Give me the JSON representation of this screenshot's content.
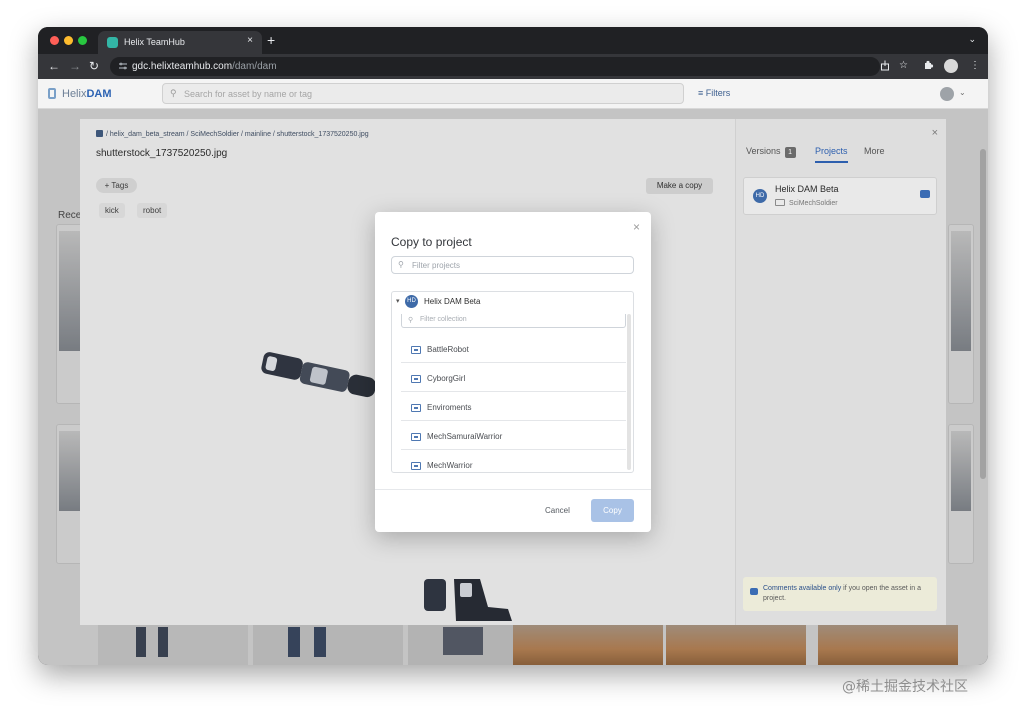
{
  "browser": {
    "tab_title": "Helix TeamHub",
    "tab_close": "×",
    "new_tab": "+",
    "tab_menu": "⌄",
    "back": "←",
    "forward": "→",
    "reload": "↻",
    "url_host": "gdc.helixteamhub.com",
    "url_path": "/dam/dam"
  },
  "app": {
    "logo_prefix": "Helix",
    "logo_suffix": "DAM",
    "search_placeholder": "Search for asset by name or tag",
    "filters_label": "Filters",
    "recent_label": "Rece"
  },
  "viewer": {
    "breadcrumb": "/ helix_dam_beta_stream / SciMechSoldier / mainline / shutterstock_1737520250.jpg",
    "asset_title": "shutterstock_1737520250.jpg",
    "add_tags": "+ Tags",
    "tags": [
      "kick",
      "robot"
    ],
    "make_copy": "Make a copy",
    "close": "×"
  },
  "side_panel": {
    "tabs": [
      {
        "label": "Versions",
        "badge": "1"
      },
      {
        "label": "Projects"
      },
      {
        "label": "More"
      }
    ],
    "project": {
      "initials": "HD",
      "name": "Helix DAM Beta",
      "sub": "SciMechSoldier"
    },
    "note": {
      "strong": "Comments available only",
      "rest": " if you open the asset in a project."
    }
  },
  "modal": {
    "title": "Copy to project",
    "close": "×",
    "filter_projects_placeholder": "Filter projects",
    "project": {
      "initials": "HD",
      "name": "Helix DAM Beta"
    },
    "filter_collection_placeholder": "Filter collection",
    "collections": [
      "BattleRobot",
      "CyborgGirl",
      "Enviroments",
      "MechSamuraiWarrior",
      "MechWarrior"
    ],
    "cancel_label": "Cancel",
    "copy_label": "Copy"
  },
  "watermark": "@稀土掘金技术社区",
  "colors": {
    "accent": "#2d5fae",
    "copy_button_disabled": "#a9c2e6",
    "tab_favicon": "#33b6a6"
  }
}
